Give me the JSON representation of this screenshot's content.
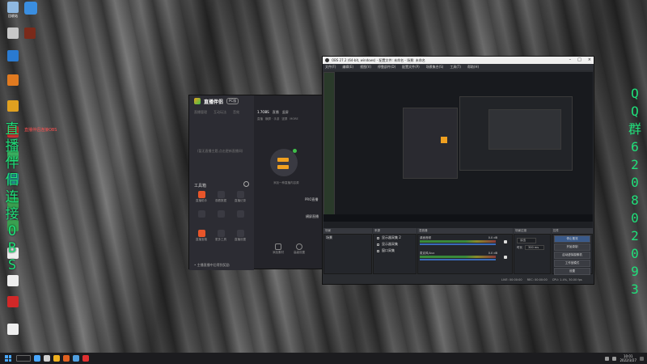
{
  "desktop": {
    "icons": [
      {
        "label": "回收站",
        "color": "#8fb8e0"
      },
      {
        "label": "",
        "color": "#c8c8c8"
      },
      {
        "label": "",
        "color": "#2a7ad0"
      },
      {
        "label": "",
        "color": "#e07a20"
      },
      {
        "label": "",
        "color": "#e0a020"
      },
      {
        "label": "",
        "color": "#c83030"
      },
      {
        "label": "",
        "color": "#3ab060"
      },
      {
        "label": "",
        "color": "#2a9a9a"
      },
      {
        "label": "",
        "color": "#3aa050"
      },
      {
        "label": "",
        "color": "#3aa050"
      },
      {
        "label": "",
        "color": "#eeeeee"
      },
      {
        "label": "",
        "color": "#eeeeee"
      },
      {
        "label": "",
        "color": "#d02828"
      },
      {
        "label": "",
        "color": "#eeeeee"
      }
    ],
    "left_green_text": [
      "直",
      "播",
      "伴",
      "侣",
      "连",
      "接",
      "O",
      "B",
      "S"
    ],
    "red_note": "直播伴侣连接OBS",
    "right_green_text": [
      "Q",
      "Q",
      "群",
      "6",
      "2",
      "0",
      "8",
      "0",
      "2",
      "0",
      "9",
      "3"
    ],
    "right_small_text": [
      "Q",
      "Q",
      "6",
      "2",
      "0",
      "8",
      "0",
      "2",
      "0",
      "9",
      "3"
    ]
  },
  "stream_app": {
    "title": "直播伴侣",
    "badge": "PC版",
    "left_tabs": [
      "直播管理",
      "互动玩法",
      "音效"
    ],
    "empty_hint": "(暂无直播主题,点击更新直播间)",
    "tools_title": "工具箱",
    "tools": [
      {
        "label": "直播助手",
        "color": "#e8552a"
      },
      {
        "label": "观看数据",
        "color": "#3a3a42"
      },
      {
        "label": "直播记录",
        "color": "#3a3a42"
      },
      {
        "label": "",
        "color": "#3a3a42"
      },
      {
        "label": "",
        "color": "#3a3a42"
      },
      {
        "label": "",
        "color": "#3a3a42"
      },
      {
        "label": "直播宝箱",
        "color": "#e8552a"
      },
      {
        "label": "更多工具",
        "color": "#3a3a42"
      },
      {
        "label": "直播设置",
        "color": "#3a3a42"
      },
      {
        "label": "",
        "color": "#3a3a42"
      },
      {
        "label": "",
        "color": "#3a3a42"
      },
      {
        "label": "",
        "color": "#3a3a42"
      }
    ],
    "footer": "• 主播直播中后得到奖励",
    "main_tabs": [
      "1.7OBS",
      "直播",
      "竖屏"
    ],
    "sub_tabs": [
      "直播",
      "横屏 · 手游",
      "竖屏",
      "MORE"
    ],
    "center_caption": "添加一种直播内容源",
    "right_label_1": "PRO直播",
    "right_label_2": "横屏直播",
    "bottom_buttons": [
      "添加素材",
      "高级设置"
    ]
  },
  "obs": {
    "title": "OBS 27.2 (64-bit, windows) - 配置文件: 未命名 - 场景: 未命名",
    "menu": [
      "文件(F)",
      "编辑(E)",
      "视图(V)",
      "停靠部件(D)",
      "配置文件(P)",
      "场景集合(S)",
      "工具(T)",
      "帮助(H)"
    ],
    "docks": {
      "scenes_title": "场景",
      "scenes": [
        "场景"
      ],
      "sources_title": "来源",
      "sources": [
        "显示器采集 2",
        "显示器采集",
        "窗口采集"
      ],
      "mixer_title": "混音器",
      "mixer": [
        {
          "label": "桌面音频",
          "db": "0.0 dB"
        },
        {
          "label": "麦克风/Aux",
          "db": "0.0 dB"
        }
      ],
      "transitions_title": "场景过渡",
      "transition_type": "淡出",
      "duration_label": "时长",
      "duration_value": "300 ms",
      "controls_title": "控件",
      "controls": [
        "停止推流",
        "开始录制",
        "启动虚拟摄像机",
        "工作室模式",
        "设置",
        "退出"
      ]
    },
    "status": [
      "LIVE: 00:00:00",
      "REC: 00:00:00",
      "CPU: 1.4%, 30.00 fps"
    ]
  },
  "taskbar": {
    "time": "10:01",
    "date": "2022/3/27",
    "apps_colors": [
      "#4aa8ff",
      "#d0d0d0",
      "#f0b020",
      "#e06020",
      "#50a0e0",
      "#e03030"
    ]
  }
}
